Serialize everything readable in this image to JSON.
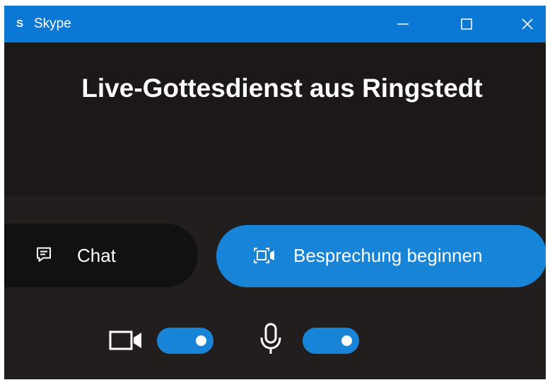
{
  "window": {
    "app_name": "Skype",
    "app_logo_letter": "S",
    "controls": [
      "minimize-icon",
      "maximize-icon",
      "close-icon"
    ],
    "titlebar_color": "#0a78d4"
  },
  "meeting": {
    "title": "Live-Gottesdienst aus Ringstedt"
  },
  "actions": {
    "chat_label": "Chat",
    "start_label": "Besprechung beginnen",
    "accent_color": "#1784d8"
  },
  "devices": {
    "camera": {
      "icon": "video-camera-icon",
      "enabled": true
    },
    "microphone": {
      "icon": "microphone-icon",
      "enabled": true
    }
  }
}
